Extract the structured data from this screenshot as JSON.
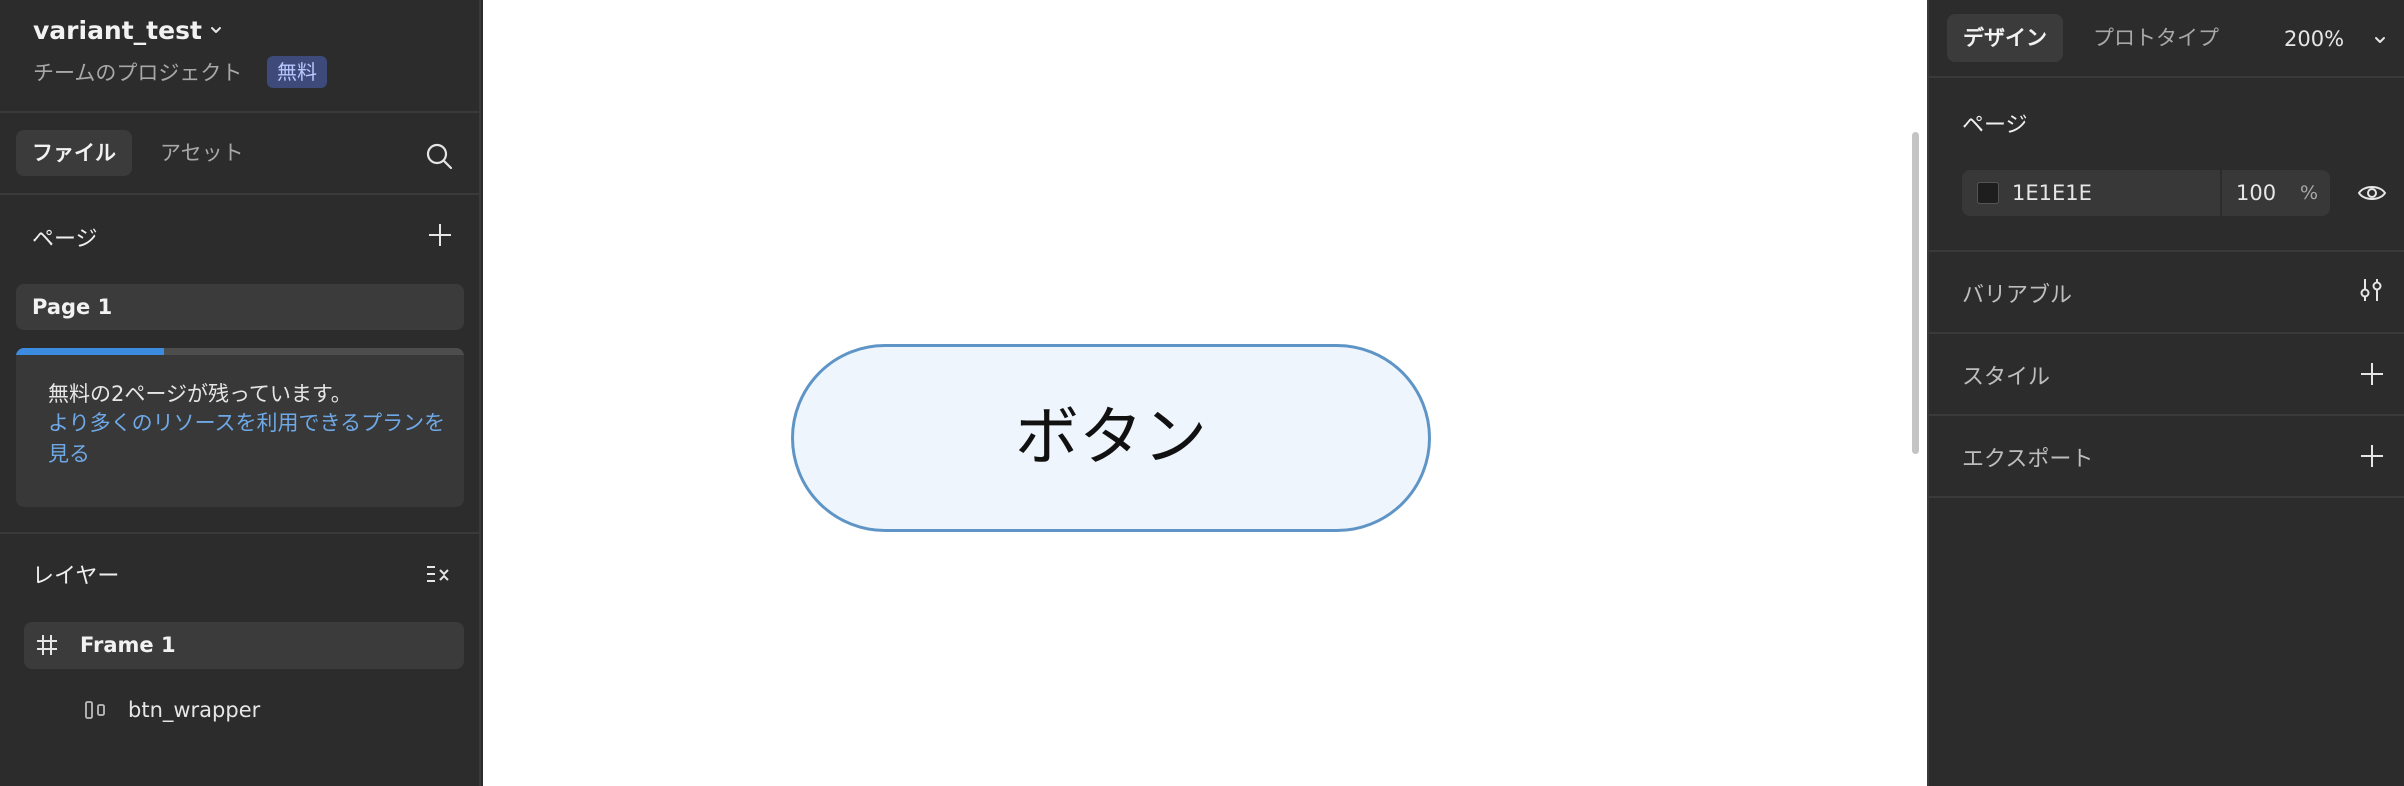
{
  "project": {
    "title": "variant_test",
    "subtitle": "チームのプロジェクト",
    "plan_badge": "無料"
  },
  "left_tabs": {
    "file": "ファイル",
    "assets": "アセット"
  },
  "pages_section": {
    "title": "ページ",
    "items": [
      {
        "label": "Page 1"
      }
    ],
    "upgrade": {
      "progress": 0.33,
      "message": "無料の2ページが残っています。",
      "link": "より多くのリソースを利用できるプランを見る"
    }
  },
  "layers_section": {
    "title": "レイヤー",
    "frame": {
      "label": "Frame 1"
    },
    "child": {
      "label": "btn_wrapper"
    }
  },
  "canvas": {
    "button_text": "ボタン",
    "button_fill": "#eef5fc",
    "button_stroke": "#5f95c6",
    "background": "#ffffff"
  },
  "right_panel": {
    "tabs": {
      "design": "デザイン",
      "prototype": "プロトタイプ"
    },
    "zoom": "200%",
    "page_section": {
      "title": "ページ",
      "color_hex": "1E1E1E",
      "swatch_color": "#1e1e1e",
      "opacity": "100",
      "percent": "%"
    },
    "variables_title": "バリアブル",
    "styles_title": "スタイル",
    "export_title": "エクスポート"
  },
  "icons": {
    "search": "search-icon",
    "plus": "plus-icon",
    "layers_menu": "list-collapse-icon",
    "frame": "hash-frame-icon",
    "autolayout": "autolayout-icon",
    "eye": "eye-icon",
    "variables": "sliders-icon",
    "chevron": "chevron-down-icon"
  }
}
